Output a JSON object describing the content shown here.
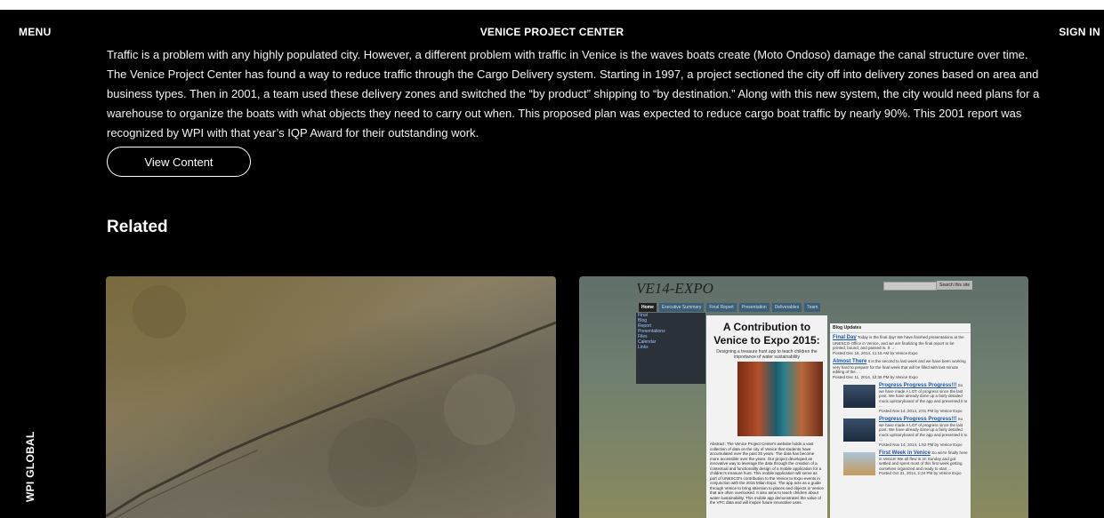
{
  "header": {
    "menu_label": "MENU",
    "site_title": "VENICE PROJECT CENTER",
    "signin_label": "SIGN IN"
  },
  "side_label": "WPI GLOBAL",
  "description": "Traffic is a problem with any highly populated city. However, a different problem with traffic in Venice is the waves boats create (Moto Ondoso) damage the canal structure over time. The Venice Project Center has found a way to reduce traffic through the Cargo Delivery system. Starting in 1997, a project sectioned the city off into delivery zones based on area and business types. Then in 2001, a team used these delivery zones and switched the “by product” shipping to “by destination.” Along with this new system, the city would need plans for a warehouse to organize the boats with what objects they need to carry out when. This proposed plan was expected to reduce cargo boat traffic by nearly 90%. This 2001 report was recognized by WPI with that year’s IQP Award for their outstanding work.",
  "view_button_label": "View Content",
  "related": {
    "heading": "Related",
    "card2": {
      "site_title": "VE14-EXPO",
      "search_button": "Search this site",
      "nav": [
        "Home",
        "Executive Summary",
        "Final Report",
        "Presentation",
        "Deliverables",
        "Team"
      ],
      "sidebar": [
        "Final",
        "Blog",
        "Report",
        "Presentations",
        "Files",
        "Calendar",
        "Links"
      ],
      "heading": "A Contribution to Venice to Expo 2015:",
      "subheading": "Designing a treasure hunt app to teach children the importance of water sustainability",
      "abstract": "Abstract: The Venice Project Center's website holds a vast collection of data on the city of Venice that students have accumulated over the past 25 years. The data has become more accessible over the years. Our project developed an innovative way to leverage the data through the creation of a contextual and functionality design of a mobile application for a children's treasure hunt. This mobile application will serve as part of UNESCO's contribution to the Venice to Expo events in conjunction with the 2015 Milan Expo. The app acts as a guide through Venice to bring attention to places and objects in Venice that are often overlooked. It also aims to teach children about water sustainability. This mobile app demonstrates the value of the VPC data and will inspire future innovative uses.",
      "blog_title": "Blog Updates",
      "posts": [
        {
          "title": "Final Day",
          "text": "Today is the final day! We have finished presentations at the UNESCO Office in Venice, and we are finalizing the final report to be printed, bound, and passed in. It ...",
          "meta": "Posted Dec 16, 2014, 11:16 AM by Venice Expo"
        },
        {
          "title": "Almost There",
          "text": "It is the second to last week and we have been working very hard to prepare for the final week that will be filled with last minute editing of the ...",
          "meta": "Posted Dec 11, 2014, 12:36 PM by Venice Expo"
        },
        {
          "title": "Progress Progress Progress!!!",
          "text": "So we have made A LOT of progress since the last post. We have already done up a fairly detailed mock up/storyboard of the app and presented it to ...",
          "meta": "Posted Nov 14, 2014, 2:01 PM by Venice Expo"
        },
        {
          "title": "Progress Progress Progress!!!",
          "text": "So we have made A LOT of progress since the last post. We have already done up a fairly detailed mock up/storyboard of the app and presented it to ...",
          "meta": "Posted Nov 14, 2014, 1:52 PM by Venice Expo"
        },
        {
          "title": "First Week in Venice",
          "text": "So we're finally here in Venice! We all flew in on Sunday and got settled and spent most of this first week getting ourselves organized and ready to start ...",
          "meta": "Posted Oct 31, 2014, 2:34 PM by Venice Expo"
        }
      ]
    }
  }
}
